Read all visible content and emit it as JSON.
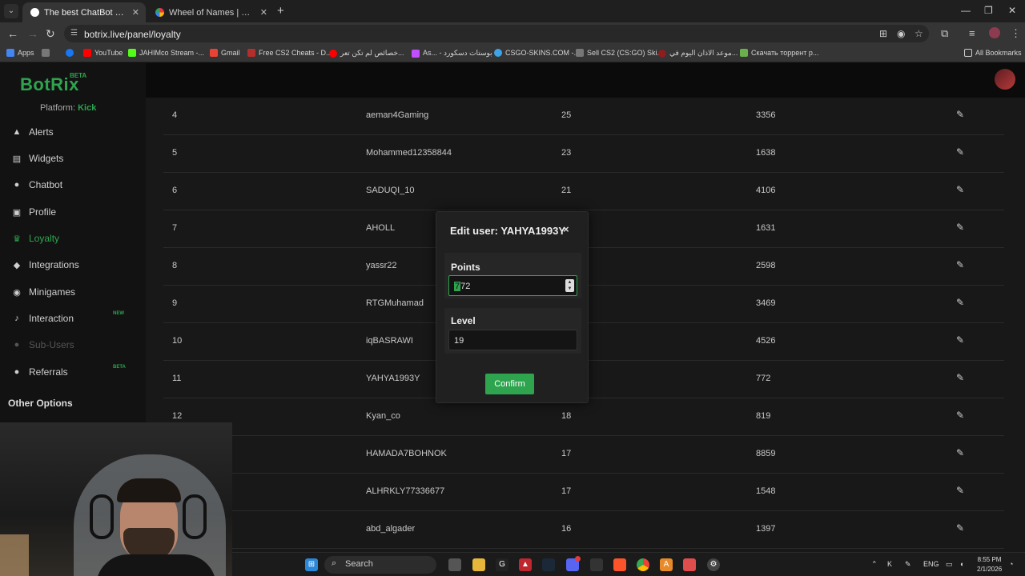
{
  "browser": {
    "tabs": [
      {
        "title": "The best ChatBot and Widgets",
        "active": true,
        "favicon_color": "#ffffff"
      },
      {
        "title": "Wheel of Names | سم العشوائي",
        "active": false,
        "favicon_color": "#3b82f6"
      }
    ],
    "new_tab": "+",
    "url": "botrix.live/panel/loyalty",
    "bookmarks": [
      {
        "label": "Apps",
        "color": "#4285f4"
      },
      {
        "label": "",
        "color": "#777777"
      },
      {
        "label": "",
        "color": "#1877f2"
      },
      {
        "label": "YouTube",
        "color": "#ff0000"
      },
      {
        "label": "JAHIMco Stream -...",
        "color": "#53fc18"
      },
      {
        "label": "Gmail",
        "color": "#ea4335"
      },
      {
        "label": "Free CS2 Cheats - D...",
        "color": "#b52e2e"
      },
      {
        "label": "خصائص لم تكن تعر...",
        "color": "#ff0000"
      },
      {
        "label": "As... - بوستات دسكورد",
        "color": "#c050ff"
      },
      {
        "label": "CSGO-SKINS.COM -...",
        "color": "#3da3e8"
      },
      {
        "label": "Sell CS2 (CS:GO) Ski...",
        "color": "#777777"
      },
      {
        "label": "موعد الاذان اليوم في...",
        "color": "#8b1e1e"
      },
      {
        "label": "Скачать торрент р...",
        "color": "#6ab04c"
      }
    ],
    "all_bookmarks": "All Bookmarks"
  },
  "app": {
    "logo": "BotRix",
    "beta": "BETA",
    "platform_label": "Platform:",
    "platform_value": "Kick",
    "nav": [
      {
        "label": "Alerts",
        "icon": "warning-icon",
        "glyph": "▲",
        "state": "normal"
      },
      {
        "label": "Widgets",
        "icon": "widgets-icon",
        "glyph": "▤",
        "state": "normal"
      },
      {
        "label": "Chatbot",
        "icon": "robot-icon",
        "glyph": "●",
        "state": "normal"
      },
      {
        "label": "Profile",
        "icon": "profile-card-icon",
        "glyph": "▣",
        "state": "normal"
      },
      {
        "label": "Loyalty",
        "icon": "trophy-icon",
        "glyph": "♛",
        "state": "active"
      },
      {
        "label": "Integrations",
        "icon": "integrations-icon",
        "glyph": "◆",
        "state": "normal"
      },
      {
        "label": "Minigames",
        "icon": "gamepad-icon",
        "glyph": "◉",
        "state": "normal"
      },
      {
        "label": "Interaction",
        "icon": "music-icon",
        "glyph": "♪",
        "state": "normal"
      },
      {
        "label": "Sub-Users",
        "icon": "sub-users-icon",
        "glyph": "●",
        "state": "disabled"
      },
      {
        "label": "Referrals",
        "icon": "referrals-icon",
        "glyph": "●",
        "state": "normal"
      }
    ],
    "nav_badges": {
      "interaction": "NEW",
      "referrals": "BETA"
    },
    "other_options": "Other Options"
  },
  "leaderboard": {
    "rows": [
      {
        "rank": "4",
        "name": "aeman4Gaming",
        "level": "25",
        "points": "3356"
      },
      {
        "rank": "5",
        "name": "Mohammed12358844",
        "level": "23",
        "points": "1638"
      },
      {
        "rank": "6",
        "name": "SADUQI_10",
        "level": "21",
        "points": "4106"
      },
      {
        "rank": "7",
        "name": "AHOLL",
        "level": "",
        "points": "1631"
      },
      {
        "rank": "8",
        "name": "yassr22",
        "level": "",
        "points": "2598"
      },
      {
        "rank": "9",
        "name": "RTGMuhamad",
        "level": "",
        "points": "3469"
      },
      {
        "rank": "10",
        "name": "iqBASRAWI",
        "level": "",
        "points": "4526"
      },
      {
        "rank": "11",
        "name": "YAHYA1993Y",
        "level": "",
        "points": "772"
      },
      {
        "rank": "12",
        "name": "Kyan_co",
        "level": "18",
        "points": "819"
      },
      {
        "rank": "",
        "name": "HAMADA7BOHNOK",
        "level": "17",
        "points": "8859"
      },
      {
        "rank": "",
        "name": "ALHRKLY77336677",
        "level": "17",
        "points": "1548"
      },
      {
        "rank": "",
        "name": "abd_algader",
        "level": "16",
        "points": "1397"
      }
    ]
  },
  "modal": {
    "title": "Edit user: YAHYA1993Y",
    "close": "×",
    "points_label": "Points",
    "points_value_first": "7",
    "points_value_rest": "72",
    "level_label": "Level",
    "level_value": "19",
    "confirm": "Confirm"
  },
  "taskbar": {
    "search": "Search",
    "lang": "ENG",
    "time": "8:55 PM",
    "date": "2/1/2026",
    "badge": "9+"
  }
}
